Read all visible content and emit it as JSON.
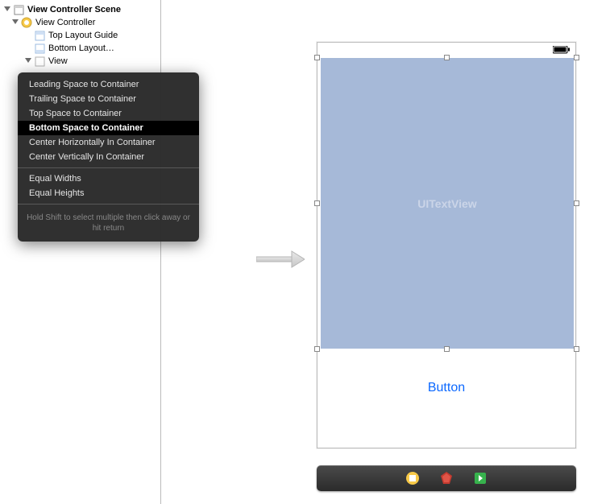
{
  "outline": {
    "scene": "View Controller Scene",
    "controller": "View Controller",
    "topGuide": "Top Layout Guide",
    "bottomGuide": "Bottom Layout…",
    "view": "View"
  },
  "popover": {
    "items": [
      "Leading Space to Container",
      "Trailing Space to Container",
      "Top Space to Container",
      "Bottom Space to Container",
      "Center Horizontally In Container",
      "Center Vertically In Container"
    ],
    "group2": [
      "Equal Widths",
      "Equal Heights"
    ],
    "hint": "Hold Shift to select multiple then click away or hit return"
  },
  "canvas": {
    "textviewLabel": "UITextView",
    "buttonLabel": "Button"
  }
}
